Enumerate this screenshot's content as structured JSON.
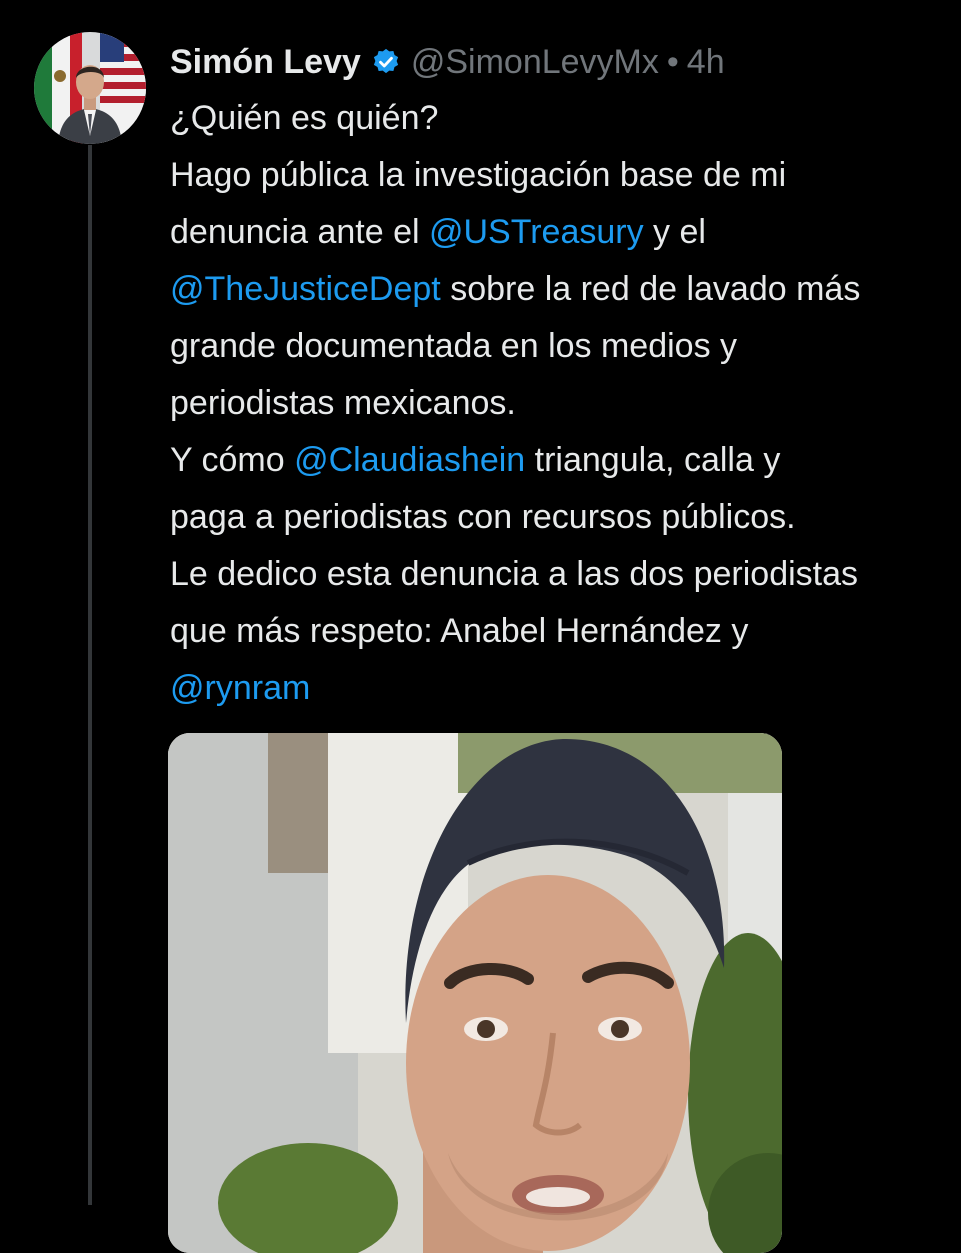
{
  "author": {
    "name": "Simón Levy",
    "handle": "@SimonLevyMx",
    "separator": "•",
    "time": "4h"
  },
  "tweet": {
    "lines": [
      [
        {
          "t": "¿Quién es quién?"
        }
      ],
      [
        {
          "t": "Hago pública la investigación base de mi"
        }
      ],
      [
        {
          "t": "denuncia ante el "
        },
        {
          "t": "@USTreasury",
          "m": true
        },
        {
          "t": " y el"
        }
      ],
      [
        {
          "t": "@TheJusticeDept",
          "m": true
        },
        {
          "t": " sobre la red de lavado más"
        }
      ],
      [
        {
          "t": "grande documentada en los medios y"
        }
      ],
      [
        {
          "t": "periodistas mexicanos."
        }
      ],
      [
        {
          "t": "Y cómo "
        },
        {
          "t": "@Claudiashein",
          "m": true
        },
        {
          "t": " triangula, calla  y"
        }
      ],
      [
        {
          "t": "paga a periodistas con recursos públicos."
        }
      ],
      [
        {
          "t": "Le dedico esta denuncia a las dos periodistas"
        }
      ],
      [
        {
          "t": "que más respeto: Anabel Hernández y"
        }
      ],
      [
        {
          "t": "@rynram",
          "m": true
        }
      ]
    ]
  },
  "colors": {
    "background": "#000000",
    "text": "#e7e9ea",
    "secondary": "#71767b",
    "mention": "#1d9bf0",
    "verified": "#1d9bf0",
    "thread_line": "#333639"
  },
  "icons": {
    "verified": "verified-badge-icon"
  }
}
